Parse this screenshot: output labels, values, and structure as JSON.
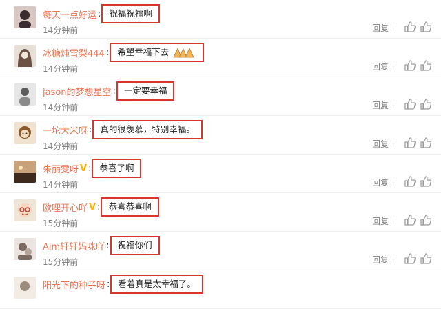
{
  "comments": [
    {
      "username": "每天一点好运",
      "verified": false,
      "text": "祝福祝福啊",
      "emoji": "",
      "time": "14分钟前",
      "avatar_colors": [
        "#d8c7c2",
        "#3a2c2e"
      ]
    },
    {
      "username": "冰糖炖雪梨444",
      "verified": false,
      "text": "希望幸福下去",
      "emoji": "pray-hands",
      "time": "14分钟前",
      "avatar_colors": [
        "#e8dfd6",
        "#6b5146"
      ]
    },
    {
      "username": "jason的梦想星空",
      "verified": false,
      "text": "一定要幸福",
      "emoji": "",
      "time": "14分钟前",
      "avatar_colors": [
        "#e6e6e6",
        "#5c5c5c"
      ]
    },
    {
      "username": "一坨大米呀",
      "verified": false,
      "text": "真的很羡慕，特别幸福。",
      "emoji": "",
      "time": "14分钟前",
      "avatar_colors": [
        "#f1e2cf",
        "#8b5a2b"
      ]
    },
    {
      "username": "朱丽雯呀",
      "verified": true,
      "text": "恭喜了啊",
      "emoji": "",
      "time": "14分钟前",
      "avatar_colors": [
        "#c7a27a",
        "#3e2a1c"
      ]
    },
    {
      "username": "欧哩开心吖",
      "verified": true,
      "text": "恭喜恭喜啊",
      "emoji": "",
      "time": "15分钟前",
      "avatar_colors": [
        "#efe6d8",
        "#c23b3b"
      ]
    },
    {
      "username": "Aim轩轩妈咪吖",
      "verified": false,
      "text": "祝福你们",
      "emoji": "",
      "time": "15分钟前",
      "avatar_colors": [
        "#ebe4e0",
        "#7a6a62"
      ]
    },
    {
      "username": "阳光下的种子呀",
      "verified": false,
      "text": "看着真是太幸福了。",
      "emoji": "",
      "time": "",
      "avatar_colors": [
        "#f3ece4",
        "#9c8c7d"
      ]
    }
  ],
  "actions": {
    "reply_label": "回复"
  },
  "colors": {
    "username": "#eb7350",
    "highlight_border": "#d9372c",
    "meta_text": "#808080"
  }
}
